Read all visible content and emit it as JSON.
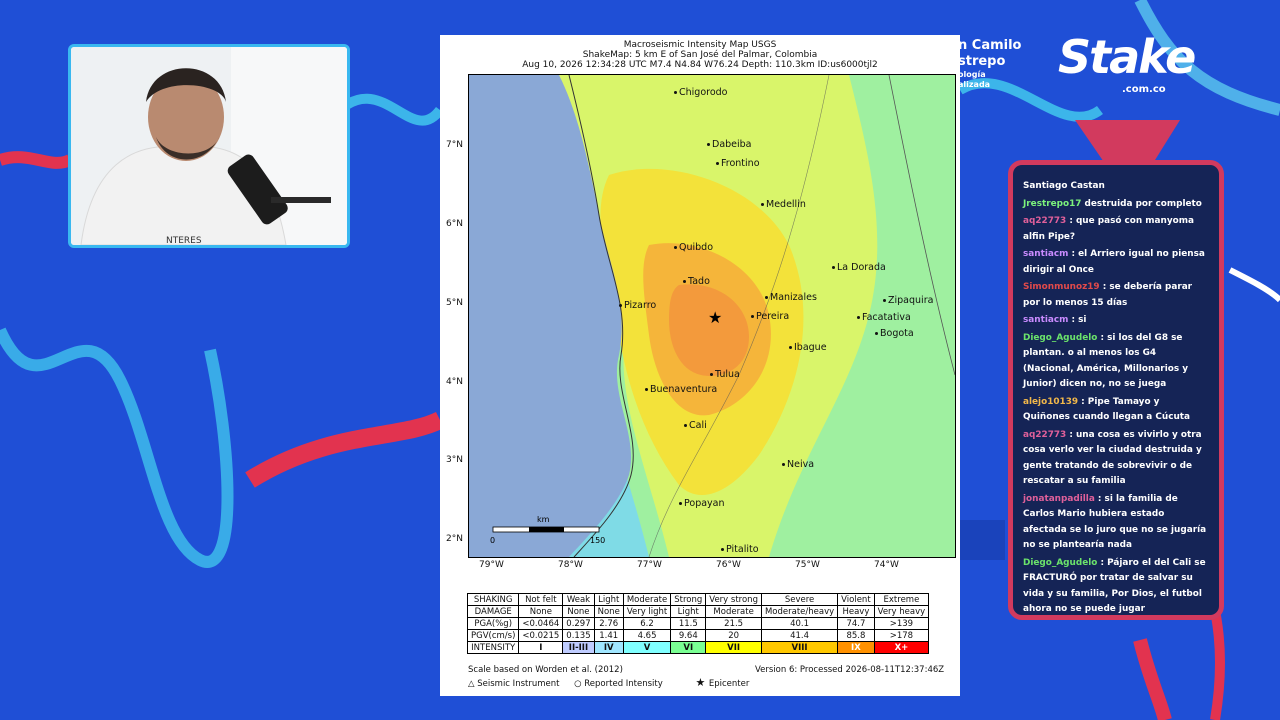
{
  "colors": {
    "background": "#1f4fd6",
    "chat_border": "#d23a5e",
    "chat_bg": "#152456",
    "webcam_border": "#39b8f0"
  },
  "branding": {
    "logo_text": "Stake",
    "logo_subtext": ".com.co",
    "host_name_lines": [
      "n Camilo",
      "strepo"
    ],
    "host_subtitle_lines": [
      "ología",
      "alizada"
    ]
  },
  "map": {
    "title_lines": [
      "Macroseismic Intensity Map USGS",
      "ShakeMap: 5 km E of San José del Palmar, Colombia",
      "Aug 10, 2026 12:34:28 UTC M7.4 N4.84 W76.24 Depth: 110.3km ID:us6000tjl2"
    ],
    "lat_labels": [
      "7°N",
      "6°N",
      "5°N",
      "4°N",
      "3°N",
      "2°N"
    ],
    "lon_labels": [
      "79°W",
      "78°W",
      "77°W",
      "76°W",
      "75°W",
      "74°W"
    ],
    "scale_bar": {
      "unit": "km",
      "min": "0",
      "max": "150"
    },
    "cities": [
      "Chigorodo",
      "Dabeiba",
      "Frontino",
      "Medellin",
      "Quibdo",
      "Tado",
      "La Dorada",
      "Manizales",
      "Zipaquira",
      "Pizarro",
      "Pereira",
      "Facatativa",
      "Bogota",
      "Ibague",
      "Tulua",
      "Buenaventura",
      "Cali",
      "Neiva",
      "Popayan",
      "Pitalito"
    ],
    "legend": {
      "rows": [
        {
          "head": "SHAKING",
          "cells": [
            "Not felt",
            "Weak",
            "Light",
            "Moderate",
            "Strong",
            "Very strong",
            "Severe",
            "Violent",
            "Extreme"
          ]
        },
        {
          "head": "DAMAGE",
          "cells": [
            "None",
            "None",
            "None",
            "Very light",
            "Light",
            "Moderate",
            "Moderate/heavy",
            "Heavy",
            "Very heavy"
          ]
        },
        {
          "head": "PGA(%g)",
          "cells": [
            "<0.0464",
            "0.297",
            "2.76",
            "6.2",
            "11.5",
            "21.5",
            "40.1",
            "74.7",
            ">139"
          ]
        },
        {
          "head": "PGV(cm/s)",
          "cells": [
            "<0.0215",
            "0.135",
            "1.41",
            "4.65",
            "9.64",
            "20",
            "41.4",
            "85.8",
            ">178"
          ]
        },
        {
          "head": "INTENSITY",
          "cells": [
            "I",
            "II-III",
            "IV",
            "V",
            "VI",
            "VII",
            "VIII",
            "IX",
            "X+"
          ]
        }
      ],
      "intensity_colors": [
        "#ffffff",
        "#bfccff",
        "#a0e6ff",
        "#80ffff",
        "#7aff93",
        "#ffff00",
        "#ffc800",
        "#ff9100",
        "#ff0000"
      ]
    },
    "footer_left": "Scale based on Worden et al. (2012)",
    "footer_right": "Version 6: Processed 2026-08-11T12:37:46Z",
    "legend_symbols": [
      "Seismic Instrument",
      "Reported Intensity",
      "Epicenter"
    ]
  },
  "chat": {
    "header": "Santiago Castan",
    "messages": [
      {
        "user": "Jrestrepo17",
        "color": "#7cf27c",
        "text": "destruida por completo"
      },
      {
        "user": "aq22773",
        "color": "#e0609a",
        "text": ": que pasó con manyoma alfin Pipe?"
      },
      {
        "user": "santiacm",
        "color": "#c98bff",
        "text": ": el Arriero igual no piensa dirigir al Once"
      },
      {
        "user": "Simonmunoz19",
        "color": "#e24a4a",
        "text": ": se debería parar por lo menos 15 días"
      },
      {
        "user": "santiacm",
        "color": "#c98bff",
        "text": ": si"
      },
      {
        "user": "Diego_Agudelo",
        "color": "#6be36b",
        "text": ": si los del G8 se plantan. o al menos los G4 (Nacional, América, Millonarios y Junior) dicen no, no se juega"
      },
      {
        "user": "alejo10139",
        "color": "#f2b84a",
        "text": ": Pipe Tamayo y Quiñones cuando llegan a Cúcuta"
      },
      {
        "user": "aq22773",
        "color": "#e0609a",
        "text": ": una cosa es vivirlo y otra cosa verlo ver la ciudad destruida y gente tratando de sobrevivir o de rescatar a su familia"
      },
      {
        "user": "jonatanpadilla",
        "color": "#e0609a",
        "text": ": si la familia de Carlos Mario hubiera estado afectada se lo juro que no se jugaría no se plantearía nada"
      },
      {
        "user": "Diego_Agudelo",
        "color": "#6be36b",
        "text": ": Pájaro el del Cali se FRACTURÓ por tratar de salvar su vida y su familia, Por Dios, el futbol ahora no se puede jugar"
      }
    ]
  }
}
